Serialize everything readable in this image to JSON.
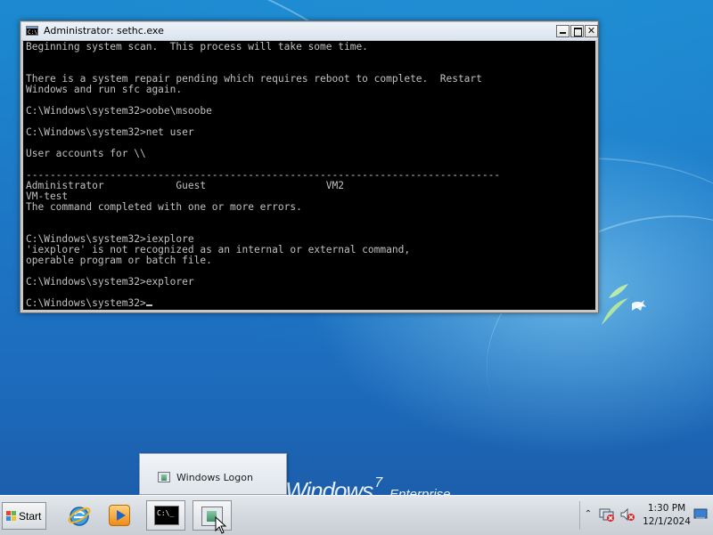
{
  "console": {
    "title": "Administrator: sethc.exe",
    "title_icon_text": "C:\\",
    "lines": [
      "Beginning system scan.  This process will take some time.",
      "",
      "",
      "There is a system repair pending which requires reboot to complete.  Restart",
      "Windows and run sfc again.",
      "",
      "C:\\Windows\\system32>oobe\\msoobe",
      "",
      "C:\\Windows\\system32>net user",
      "",
      "User accounts for \\\\",
      "",
      "-------------------------------------------------------------------------------",
      "Administrator            Guest                    VM2",
      "VM-test",
      "The command completed with one or more errors.",
      "",
      "",
      "C:\\Windows\\system32>iexplore",
      "'iexplore' is not recognized as an internal or external command,",
      "operable program or batch file.",
      "",
      "C:\\Windows\\system32>explorer",
      ""
    ],
    "prompt": "C:\\Windows\\system32>",
    "buttons": {
      "minimize": "minimize",
      "maximize": "maximize",
      "close": "✕"
    }
  },
  "desktop": {
    "brand_word": "Windows",
    "brand_version": "7",
    "brand_edition": "Enterprise"
  },
  "taskbar": {
    "start_label": "Start",
    "cmd_icon_text": "C:\\_",
    "pinned": [
      {
        "name": "internet-explorer",
        "icon": "internet-explorer-icon"
      },
      {
        "name": "windows-media-player",
        "icon": "media-player-icon"
      },
      {
        "name": "command-prompt",
        "icon": "cmd-icon",
        "active": true
      },
      {
        "name": "windows-logon",
        "icon": "windows-logon-icon",
        "active": true
      }
    ]
  },
  "popup": {
    "label": "Windows Logon"
  },
  "tray": {
    "show_hidden_glyph": "⌃",
    "time": "1:30 PM",
    "date": "12/1/2024"
  },
  "colors": {
    "console_bg": "#000000",
    "console_text": "#c0c0c0",
    "desktop_blue": "#1d79c7"
  }
}
